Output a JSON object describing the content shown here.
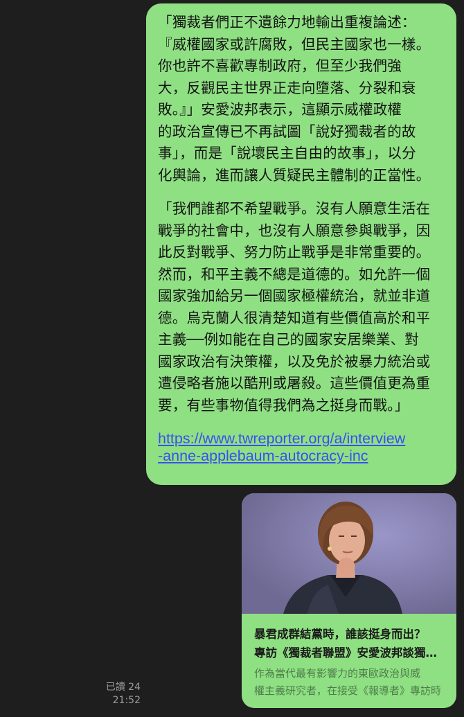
{
  "message": {
    "paragraphs": [
      "「獨裁者們正不遺餘力地輸出重複論述：\n『威權國家或許腐敗，但民主國家也一樣。\n你也許不喜歡專制政府，但至少我們強\n大，反觀民主世界正走向墮落、分裂和衰\n敗。』」安愛波邦表示，這顯示威權政權\n的政治宣傳已不再試圖「說好獨裁者的故\n事」，而是「說壞民主自由的故事」，以分\n化輿論，進而讓人質疑民主體制的正當性。",
      "「我們誰都不希望戰爭。沒有人願意生活在\n戰爭的社會中，也沒有人願意參與戰爭，因\n此反對戰爭、努力防止戰爭是非常重要的。\n然而，和平主義不總是道德的。如允許一個\n國家強加給另一個國家極權統治，就並非道\n德。烏克蘭人很清楚知道有些價值高於和平\n主義──例如能在自己的國家安居樂業、對\n國家政治有決策權，以及免於被暴力統治或\n遭侵略者施以酷刑或屠殺。這些價值更為重\n要，有些事物值得我們為之挺身而戰。」"
    ],
    "link": "https://www.twreporter.org/a/interview\n-anne-applebaum-autocracy-inc"
  },
  "preview": {
    "title": "暴君成群結黨時，誰該挺身而出？專訪《獨裁者聯盟》安愛波邦談獨裁者的結盟與民主的反擊",
    "title_line1": "暴君成群結黨時，誰該挺身而出？",
    "title_line2": "專訪《獨裁者聯盟》安愛波邦談獨裁者的結盟與民主的反擊",
    "desc_line1": "作為當代最有影響力的東歐政治與威",
    "desc_line2": "權主義研究者，在接受《報導者》專訪時"
  },
  "status": {
    "read": "已讀 24",
    "time": "21:52"
  },
  "colors": {
    "background": "#1e1e1e",
    "bubble": "#8fe083",
    "link": "#3a4ff0",
    "meta": "#9b9b9b"
  }
}
